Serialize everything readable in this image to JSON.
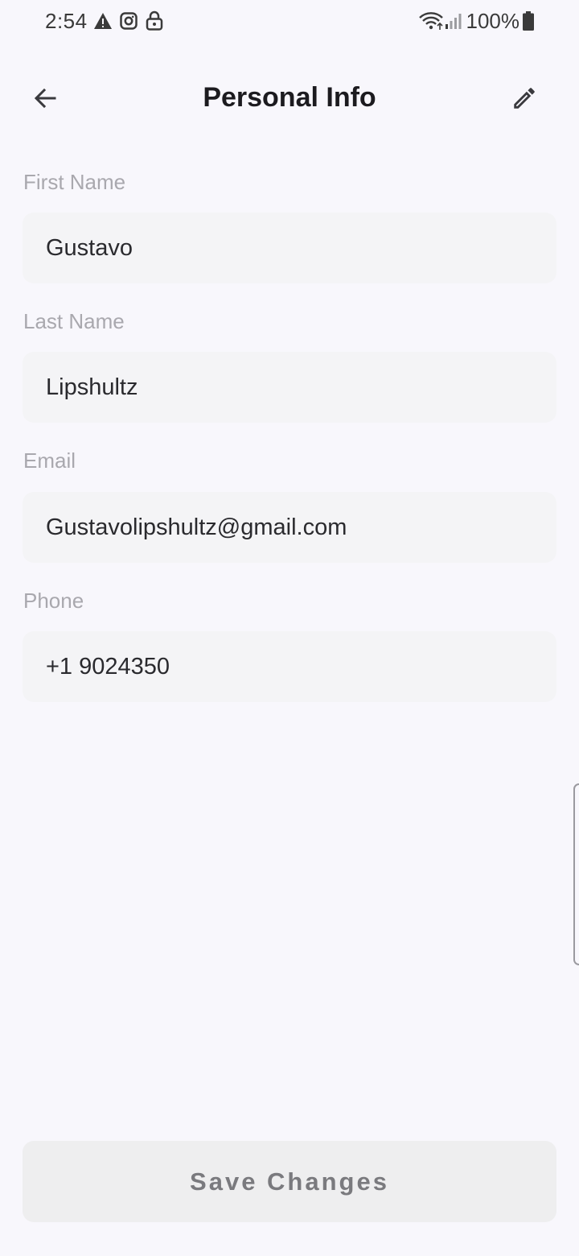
{
  "status_bar": {
    "time": "2:54",
    "battery": "100%",
    "icons": [
      "warning-icon",
      "instagram-icon",
      "lock-icon",
      "wifi-icon",
      "signal-icon",
      "battery-icon"
    ]
  },
  "header": {
    "title": "Personal Info",
    "back_icon": "back-arrow-icon",
    "edit_icon": "pencil-icon"
  },
  "form": {
    "fields": [
      {
        "label": "First Name",
        "value": "Gustavo"
      },
      {
        "label": "Last Name",
        "value": "Lipshultz"
      },
      {
        "label": "Email",
        "value": "Gustavolipshultz@gmail.com"
      },
      {
        "label": "Phone",
        "value": "+1 9024350"
      }
    ]
  },
  "footer": {
    "save_label": "Save Changes"
  },
  "colors": {
    "background": "#f8f7fc",
    "field_background": "#f4f4f6",
    "label": "#a9a8ae",
    "button_background": "#eeeeef",
    "button_text": "#7a7a7e"
  }
}
